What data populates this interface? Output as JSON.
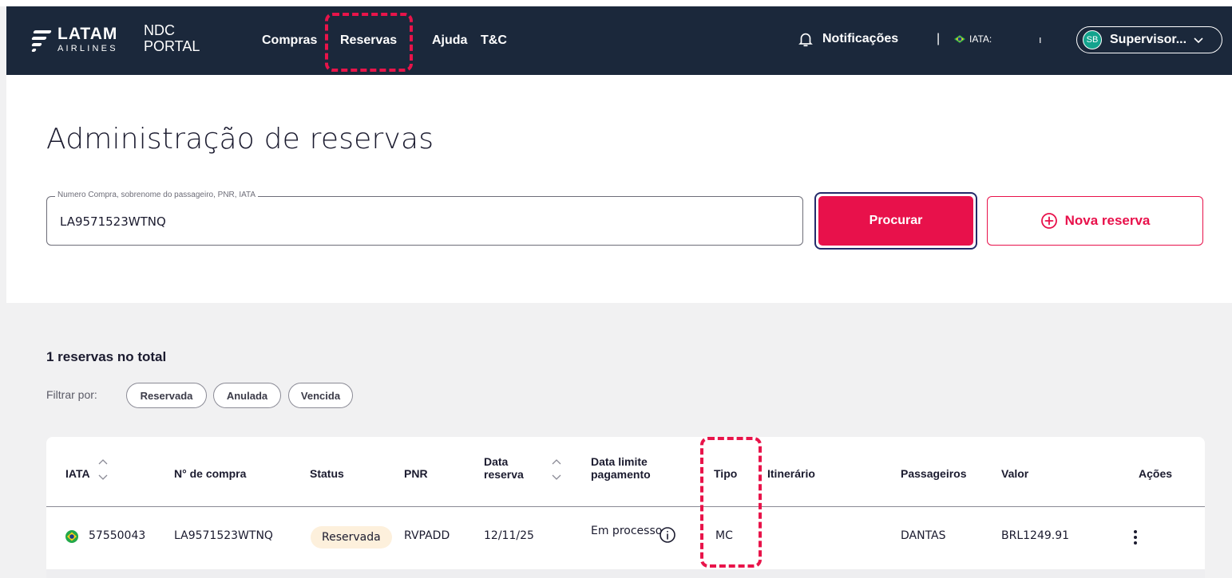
{
  "brand": {
    "logo_top": "LATAM",
    "logo_bottom": "AIRLINES",
    "portal_line1": "NDC",
    "portal_line2": "PORTAL"
  },
  "nav": {
    "links": [
      "Compras",
      "Reservas",
      "Ajuda",
      "T&C"
    ],
    "notifications": "Notificações",
    "separator": "|",
    "iata_label": "IATA:",
    "iata_sep": "ı",
    "user_initials": "SB",
    "user_name": "Supervisor..."
  },
  "page": {
    "title": "Administração de reservas"
  },
  "search": {
    "label": "Numero Compra, sobrenome do passageiro, PNR, IATA",
    "value": "LA9571523WTNQ",
    "search_button": "Procurar",
    "new_button": "Nova reserva"
  },
  "results": {
    "total": "1 reservas no total",
    "filter_label": "Filtrar por:",
    "filters": [
      "Reservada",
      "Anulada",
      "Vencida"
    ]
  },
  "table": {
    "headers": {
      "iata": "IATA",
      "compra": "N° de compra",
      "status": "Status",
      "pnr": "PNR",
      "data_reserva_1": "Data",
      "data_reserva_2": "reserva",
      "data_limite_1": "Data limite",
      "data_limite_2": "pagamento",
      "tipo": "Tipo",
      "itinerario": "Itinerário",
      "passageiros": "Passageiros",
      "valor": "Valor",
      "acoes": "Ações"
    },
    "rows": [
      {
        "iata": "57550043",
        "compra": "LA9571523WTNQ",
        "status": "Reservada",
        "pnr": "RVPADD",
        "data_reserva": "12/11/25",
        "data_limite": "Em processo",
        "tipo": "MC",
        "itinerario": "",
        "passageiros": "DANTAS",
        "valor": "BRL1249.91"
      }
    ]
  },
  "colors": {
    "navbar": "#1b283b",
    "accent": "#e8114b",
    "highlight_dash": "#e8144a",
    "badge_bg": "#fdf0dc"
  }
}
